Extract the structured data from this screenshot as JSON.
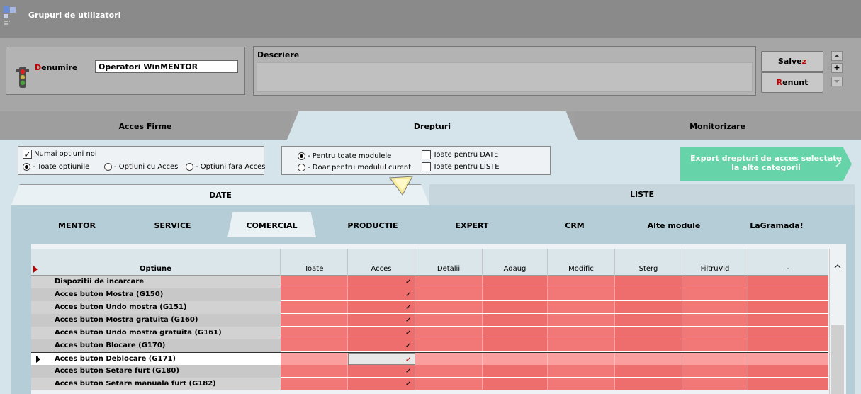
{
  "window": {
    "title": "Grupuri de utilizatori"
  },
  "header": {
    "name_label_first": "D",
    "name_label_rest": "enumire",
    "name_value": "Operatori WinMENTOR",
    "desc_label": "Descriere",
    "desc_value": "",
    "save_label_main": "Salve",
    "save_label_accent": "z",
    "cancel_label_accent": "R",
    "cancel_label_main": "enunt",
    "plus": "+"
  },
  "tabs": [
    {
      "label": "Acces Firme"
    },
    {
      "label": "Drepturi",
      "active": true
    },
    {
      "label": "Monitorizare"
    }
  ],
  "options": {
    "only_new": {
      "label": "Numai optiuni noi",
      "checked": true
    },
    "filter_radios": [
      {
        "label": "- Toate optiunile",
        "checked": true
      },
      {
        "label": "- Optiuni cu  Acces",
        "checked": false
      },
      {
        "label": "- Optiuni fara Acces",
        "checked": false
      }
    ],
    "module_radios": [
      {
        "label": "- Pentru toate modulele",
        "checked": true
      },
      {
        "label": "- Doar pentru modulul curent",
        "checked": false
      }
    ],
    "bulk_checks": [
      {
        "label": "Toate pentru DATE",
        "checked": false
      },
      {
        "label": "Toate pentru LISTE",
        "checked": false
      }
    ],
    "export_line1": "Export drepturi de acces selectate",
    "export_line2": "la alte categorii"
  },
  "subtabs": [
    {
      "label": "DATE",
      "active": true
    },
    {
      "label": "LISTE"
    }
  ],
  "module_tabs": [
    {
      "label": "MENTOR"
    },
    {
      "label": "SERVICE"
    },
    {
      "label": "COMERCIAL",
      "active": true
    },
    {
      "label": "PRODUCTIE"
    },
    {
      "label": "EXPERT"
    },
    {
      "label": "CRM"
    },
    {
      "label": "Alte module"
    },
    {
      "label": "LaGramada!"
    }
  ],
  "grid": {
    "columns": [
      "Optiune",
      "Toate",
      "Acces",
      "Detalii",
      "Adaug",
      "Modific",
      "Sterg",
      "FiltruVid",
      "-"
    ],
    "rows": [
      {
        "name": "Dispozitii de incarcare",
        "acces": "✓"
      },
      {
        "name": "Acces buton Mostra (G150)",
        "acces": "✓"
      },
      {
        "name": "Acces buton Undo mostra (G151)",
        "acces": "✓"
      },
      {
        "name": "Acces buton Mostra gratuita (G160)",
        "acces": "✓"
      },
      {
        "name": "Acces buton Undo mostra gratuita (G161)",
        "acces": "✓"
      },
      {
        "name": "Acces buton Blocare (G170)",
        "acces": "✓"
      },
      {
        "name": "Acces buton Deblocare (G171)",
        "acces": "✓",
        "selected": true
      },
      {
        "name": "Acces buton Setare furt (G180)",
        "acces": "✓"
      },
      {
        "name": "Acces buton Setare manuala furt (G182)",
        "acces": "✓"
      }
    ]
  },
  "colors": {
    "cell_red": "#f27878",
    "cell_red_alt": "#ee6e6e",
    "selected_row": "#fa9e9e",
    "export_green": "#66d4a8",
    "accent_red": "#c00000"
  },
  "icons": [
    "app-icon",
    "traffic-light-icon",
    "up-arrow-icon",
    "down-arrow-icon",
    "chevron-right-icon",
    "cursor-arrow-icon"
  ]
}
